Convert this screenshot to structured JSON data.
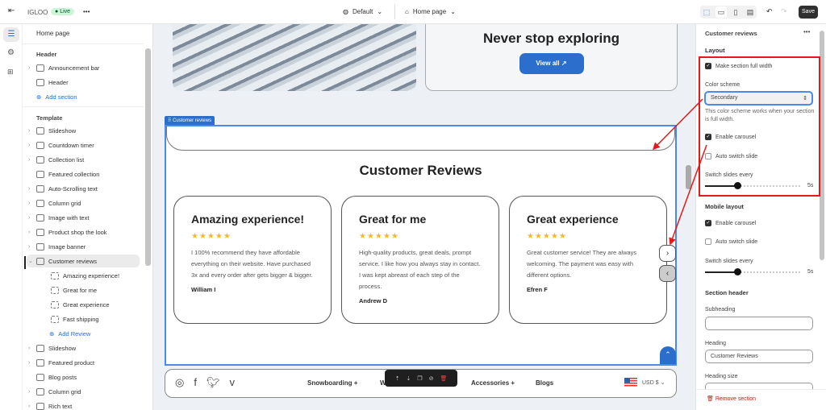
{
  "topbar": {
    "store": "IGLOO",
    "status": "Live",
    "more": "•••",
    "theme": "Default",
    "page": "Home page",
    "save": "Save"
  },
  "sidebar": {
    "title": "Home page",
    "header_label": "Header",
    "header_items": [
      {
        "label": "Announcement bar",
        "chev": true
      },
      {
        "label": "Header",
        "chev": false
      }
    ],
    "add_section": "Add section",
    "template_label": "Template",
    "template_items": [
      {
        "label": "Slideshow",
        "chev": true
      },
      {
        "label": "Countdown timer",
        "chev": true
      },
      {
        "label": "Collection list",
        "chev": true
      },
      {
        "label": "Featured collection",
        "chev": false
      },
      {
        "label": "Auto-Scrolling text",
        "chev": true
      },
      {
        "label": "Column grid",
        "chev": true
      },
      {
        "label": "Image with text",
        "chev": true
      },
      {
        "label": "Product shop the look",
        "chev": true
      },
      {
        "label": "Image banner",
        "chev": true
      },
      {
        "label": "Customer reviews",
        "chev": true,
        "selected": true
      }
    ],
    "review_blocks": [
      "Amazing experience!",
      "Great for me",
      "Great experience",
      "Fast shipping"
    ],
    "add_review": "Add Review",
    "after_items": [
      {
        "label": "Slideshow",
        "chev": true
      },
      {
        "label": "Featured product",
        "chev": true
      },
      {
        "label": "Blog posts",
        "chev": false
      },
      {
        "label": "Column grid",
        "chev": true
      },
      {
        "label": "Rich text",
        "chev": true
      }
    ]
  },
  "canvas": {
    "banner_heading": "Never stop exploring",
    "banner_button": "View all",
    "section_tag": "Customer reviews",
    "heading": "Customer Reviews",
    "reviews": [
      {
        "title": "Amazing experience!",
        "stars": 5,
        "text": "I 100% recommend they have affordable everything on their website. Have purchased 3x and every order after gets bigger & bigger.",
        "author": "William I"
      },
      {
        "title": "Great for me",
        "stars": 5,
        "text": "High-quality products, great deals, prompt service. I like how you always stay in contact. I was kept abreast of each step of the process.",
        "author": "Andrew D"
      },
      {
        "title": "Great experience",
        "stars": 5,
        "text": "Great customer service! They are always welcoming. The payment was easy with different options.",
        "author": "Efren F"
      }
    ],
    "footer": {
      "nav": [
        "Snowboarding +",
        "W",
        "Accessories +",
        "Blogs"
      ],
      "currency": "USD $"
    }
  },
  "panel": {
    "title": "Customer reviews",
    "layout": "Layout",
    "full_width": "Make section full width",
    "full_width_checked": true,
    "color_scheme_label": "Color scheme",
    "color_scheme": "Secondary",
    "color_help": "This color scheme works when your section is full width.",
    "enable_carousel": "Enable carousel",
    "enable_carousel_checked": true,
    "auto_switch": "Auto switch slide",
    "auto_switch_checked": false,
    "switch_every": "Switch slides every",
    "switch_value": "5s",
    "switch_fraction": 0.33,
    "mobile_layout": "Mobile layout",
    "m_enable_carousel": "Enable carousel",
    "m_auto_switch": "Auto switch slide",
    "m_switch_every": "Switch slides every",
    "m_switch_value": "5s",
    "m_switch_fraction": 0.33,
    "section_header": "Section header",
    "subheading_label": "Subheading",
    "subheading_value": "",
    "heading_label": "Heading",
    "heading_value": "Customer Reviews",
    "heading_size_label": "Heading size",
    "remove": "Remove section"
  },
  "colors": {
    "accent": "#2c6ecb",
    "annotation": "#e5191c",
    "star": "#f2b832"
  }
}
